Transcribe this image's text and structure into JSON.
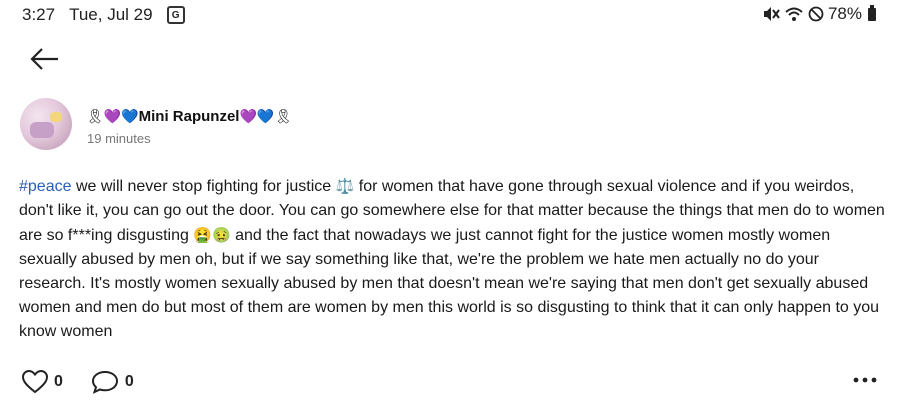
{
  "status_bar": {
    "time": "3:27",
    "date": "Tue, Jul 29",
    "notification_icon": "G",
    "battery": "78%",
    "icons": [
      "mute-icon",
      "wifi-icon",
      "do-not-disturb-icon",
      "battery-icon"
    ]
  },
  "nav": {
    "back_icon": "arrow-left-icon"
  },
  "post": {
    "author": {
      "prefix_emoji": "🎗💜💙",
      "name": "Mini Rapunzel",
      "suffix_emoji": "💜💙🎗"
    },
    "timestamp": "19 minutes",
    "hashtag": "#peace",
    "text_part1": " we will never stop fighting for justice ",
    "emoji_scales": "⚖️",
    "text_part2": " for women that have gone through sexual violence and if you weirdos, don't like it, you can go out the door. You can go somewhere else for that matter because the things that men do to women are so f***ing disgusting ",
    "emoji_sick": "🤮🤢",
    "text_part3": " and the fact that nowadays we just cannot fight for the justice women mostly women sexually abused by men oh, but if we say something like that, we're the problem we hate men actually no do your research. It's mostly women sexually abused by men that doesn't mean we're saying that men don't get sexually abused women and men do but most of them are women by men this world is so disgusting to think that it can only happen to you know women"
  },
  "actions": {
    "likes": "0",
    "comments": "0",
    "like_icon": "heart-icon",
    "comment_icon": "comment-icon",
    "more_icon": "more-options-icon"
  }
}
